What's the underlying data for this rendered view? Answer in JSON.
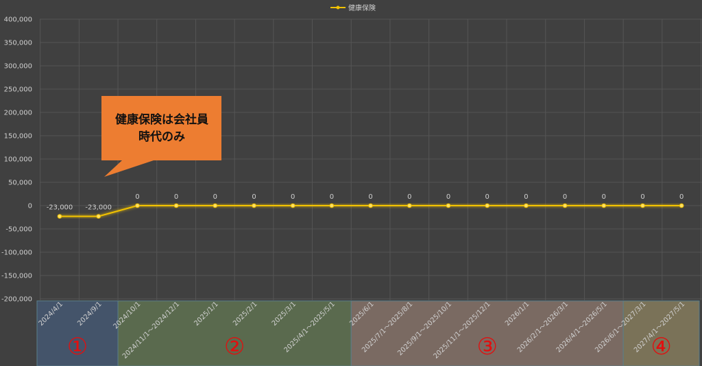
{
  "chart_data": {
    "type": "line",
    "categories": [
      "2024/4/1",
      "2024/9/1",
      "2024/10/1",
      "2024/11/1～2024/12/1",
      "2025/1/1",
      "2025/2/1",
      "2025/3/1",
      "2025/4/1～2025/5/1",
      "2025/6/1",
      "2025/7/1～2025/8/1",
      "2025/9/1～2025/10/1",
      "2025/11/1～2025/12/1",
      "2026/1/1",
      "2026/2/1～2026/3/1",
      "2026/4/1～2026/5/1",
      "2026/6/1～2027/3/1",
      "2027/4/1～2027/5/1"
    ],
    "series": [
      {
        "name": "健康保険",
        "values": [
          -23000,
          -23000,
          0,
          0,
          0,
          0,
          0,
          0,
          0,
          0,
          0,
          0,
          0,
          0,
          0,
          0,
          0
        ],
        "color": "#f2c200"
      }
    ],
    "data_labels": [
      "-23,000",
      "-23,000",
      "0",
      "0",
      "0",
      "0",
      "0",
      "0",
      "0",
      "0",
      "0",
      "0",
      "0",
      "0",
      "0",
      "0",
      "0"
    ],
    "y_ticks": [
      "400,000",
      "350,000",
      "300,000",
      "250,000",
      "200,000",
      "150,000",
      "100,000",
      "50,000",
      "0",
      "-50,000",
      "-100,000",
      "-150,000",
      "-200,000"
    ],
    "ylim": [
      -200000,
      400000
    ],
    "grid": true,
    "legend_position": "top-center",
    "callout": {
      "line1": "健康保険は会社員",
      "line2": "時代のみ",
      "color": "#ed7d31"
    },
    "sections": [
      {
        "label": "①",
        "start": 0,
        "end": 1,
        "color": "#44546a"
      },
      {
        "label": "②",
        "start": 2,
        "end": 7,
        "color": "#5a6a4e"
      },
      {
        "label": "③",
        "start": 8,
        "end": 14,
        "color": "#7a6a62"
      },
      {
        "label": "④",
        "start": 15,
        "end": 16,
        "color": "#7a7258"
      }
    ]
  }
}
